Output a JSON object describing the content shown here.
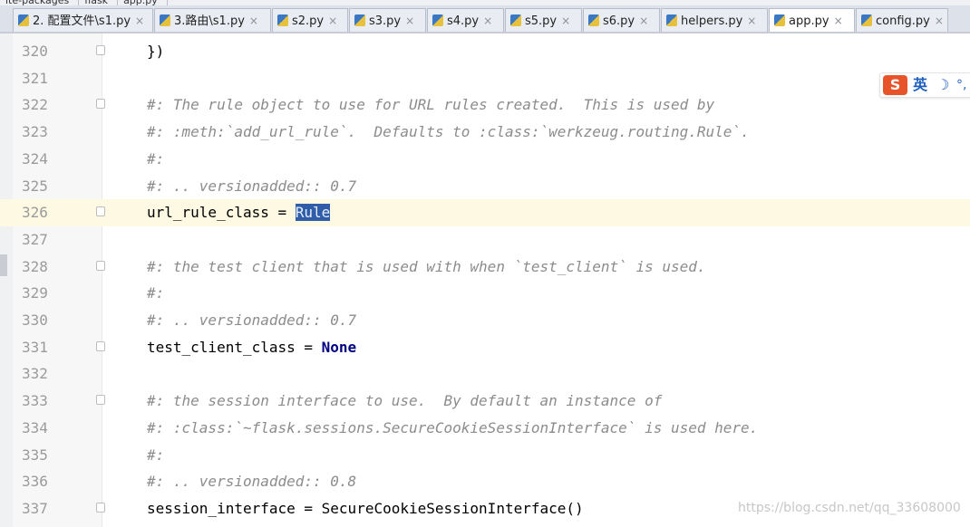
{
  "breadcrumbs": [
    "ite-packages",
    "flask",
    "app.py"
  ],
  "tabs": [
    {
      "label": "2. 配置文件\\s1.py",
      "active": false
    },
    {
      "label": "3.路由\\s1.py",
      "active": false
    },
    {
      "label": "s2.py",
      "active": false
    },
    {
      "label": "s3.py",
      "active": false
    },
    {
      "label": "s4.py",
      "active": false
    },
    {
      "label": "s5.py",
      "active": false
    },
    {
      "label": "s6.py",
      "active": false
    },
    {
      "label": "helpers.py",
      "active": false
    },
    {
      "label": "app.py",
      "active": true
    },
    {
      "label": "config.py",
      "active": false
    }
  ],
  "tab_close_glyph": "×",
  "current_line": "326",
  "code_lines": [
    {
      "num": "320",
      "text": "})"
    },
    {
      "num": "321",
      "text": ""
    },
    {
      "num": "322",
      "text": "#: The rule object to use for URL rules created.  This is used by"
    },
    {
      "num": "323",
      "text": "#: :meth:`add_url_rule`.  Defaults to :class:`werkzeug.routing.Rule`."
    },
    {
      "num": "324",
      "text": "#:"
    },
    {
      "num": "325",
      "text": "#: .. versionadded:: 0.7"
    },
    {
      "num": "326",
      "text": "url_rule_class = ",
      "selected": "Rule"
    },
    {
      "num": "327",
      "text": ""
    },
    {
      "num": "328",
      "text": "#: the test client that is used with when `test_client` is used."
    },
    {
      "num": "329",
      "text": "#:"
    },
    {
      "num": "330",
      "text": "#: .. versionadded:: 0.7"
    },
    {
      "num": "331",
      "text": "test_client_class = ",
      "keyword": "None"
    },
    {
      "num": "332",
      "text": ""
    },
    {
      "num": "333",
      "text": "#: the session interface to use.  By default an instance of"
    },
    {
      "num": "334",
      "text": "#: :class:`~flask.sessions.SecureCookieSessionInterface` is used here."
    },
    {
      "num": "335",
      "text": "#:"
    },
    {
      "num": "336",
      "text": "#: .. versionadded:: 0.8"
    },
    {
      "num": "337",
      "text": "session_interface = SecureCookieSessionInterface()"
    }
  ],
  "ime": {
    "logo": "S",
    "lang": "英",
    "moon": "☽",
    "dots": "°,"
  },
  "watermark": "https://blog.csdn.net/qq_33608000"
}
